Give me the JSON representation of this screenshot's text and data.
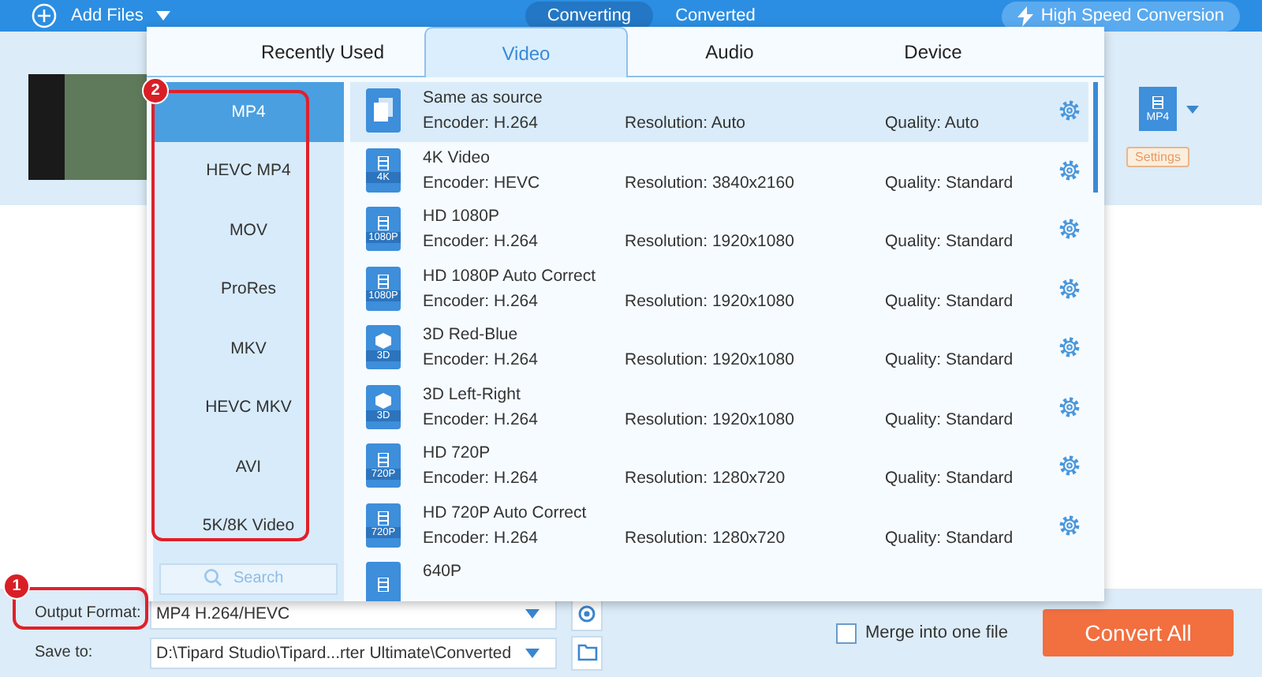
{
  "toolbar": {
    "add_files": "Add Files",
    "tabs": [
      {
        "label": "Converting",
        "selected": true
      },
      {
        "label": "Converted",
        "selected": false
      }
    ],
    "speed_button": "High Speed Conversion"
  },
  "file_item": {
    "format_badge": "MP4",
    "settings": "Settings"
  },
  "format_panel": {
    "tabs": [
      {
        "label": "Recently Used",
        "selected": false
      },
      {
        "label": "Video",
        "selected": true
      },
      {
        "label": "Audio",
        "selected": false
      },
      {
        "label": "Device",
        "selected": false
      }
    ],
    "formats": [
      {
        "label": "MP4",
        "selected": true
      },
      {
        "label": "HEVC MP4",
        "selected": false
      },
      {
        "label": "MOV",
        "selected": false
      },
      {
        "label": "ProRes",
        "selected": false
      },
      {
        "label": "MKV",
        "selected": false
      },
      {
        "label": "HEVC MKV",
        "selected": false
      },
      {
        "label": "AVI",
        "selected": false
      },
      {
        "label": "5K/8K Video",
        "selected": false
      }
    ],
    "search": {
      "placeholder": "Search"
    },
    "presets": [
      {
        "kind": "copy",
        "name": "Same as source",
        "encoder": "Encoder: H.264",
        "resolution": "Resolution: Auto",
        "quality": "Quality: Auto",
        "selected": true
      },
      {
        "kind": "film",
        "badge": "4K",
        "name": "4K Video",
        "encoder": "Encoder: HEVC",
        "resolution": "Resolution: 3840x2160",
        "quality": "Quality: Standard",
        "selected": false
      },
      {
        "kind": "film",
        "badge": "1080P",
        "name": "HD 1080P",
        "encoder": "Encoder: H.264",
        "resolution": "Resolution: 1920x1080",
        "quality": "Quality: Standard",
        "selected": false
      },
      {
        "kind": "film",
        "badge": "1080P",
        "name": "HD 1080P Auto Correct",
        "encoder": "Encoder: H.264",
        "resolution": "Resolution: 1920x1080",
        "quality": "Quality: Standard",
        "selected": false
      },
      {
        "kind": "cube",
        "badge": "3D",
        "name": "3D Red-Blue",
        "encoder": "Encoder: H.264",
        "resolution": "Resolution: 1920x1080",
        "quality": "Quality: Standard",
        "selected": false
      },
      {
        "kind": "cube",
        "badge": "3D",
        "name": "3D Left-Right",
        "encoder": "Encoder: H.264",
        "resolution": "Resolution: 1920x1080",
        "quality": "Quality: Standard",
        "selected": false
      },
      {
        "kind": "film",
        "badge": "720P",
        "name": "HD 720P",
        "encoder": "Encoder: H.264",
        "resolution": "Resolution: 1280x720",
        "quality": "Quality: Standard",
        "selected": false
      },
      {
        "kind": "film",
        "badge": "720P",
        "name": "HD 720P Auto Correct",
        "encoder": "Encoder: H.264",
        "resolution": "Resolution: 1280x720",
        "quality": "Quality: Standard",
        "selected": false
      },
      {
        "kind": "film",
        "name": "640P",
        "selected": false
      }
    ]
  },
  "bottom_bar": {
    "output_format_label": "Output Format:",
    "output_format": "MP4 H.264/HEVC",
    "save_to_label": "Save to:",
    "save_path": "D:\\Tipard Studio\\Tipard...rter Ultimate\\Converted",
    "merge": {
      "label": "Merge into one file",
      "checked": false
    },
    "convert_all": "Convert All"
  },
  "annotations": [
    {
      "number": "1"
    },
    {
      "number": "2"
    }
  ]
}
